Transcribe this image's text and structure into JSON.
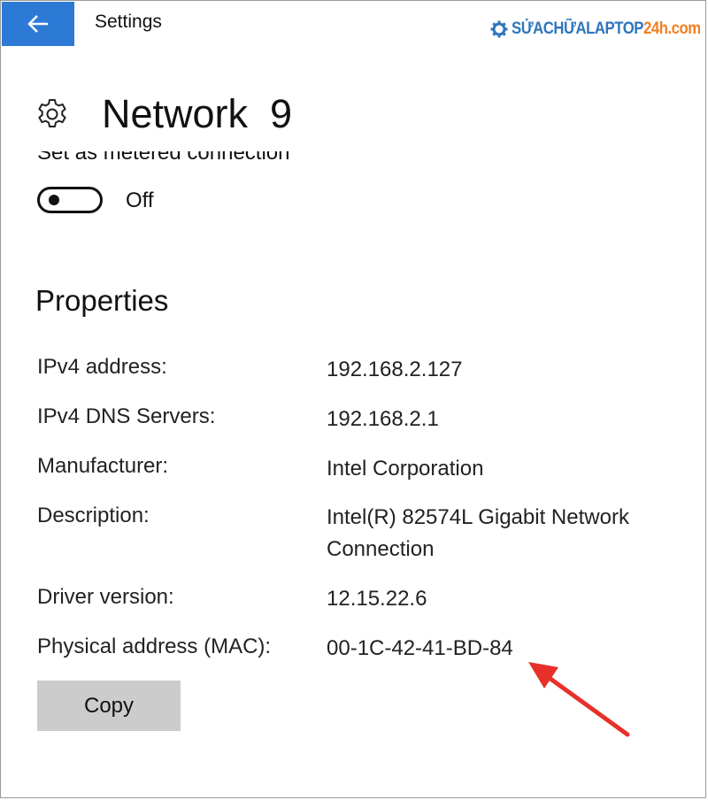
{
  "window": {
    "title": "Settings",
    "accent": "#2d7ad6"
  },
  "watermark": {
    "part_a": "SỬACHỮALAPTOP",
    "part_b": "24h.com",
    "icon": "gear-icon"
  },
  "page": {
    "icon": "gear-icon",
    "title": "Network  9"
  },
  "metered": {
    "label": "Set as metered connection",
    "state_label": "Off",
    "on": false
  },
  "properties": {
    "title": "Properties",
    "rows": [
      {
        "label": "IPv4 address:",
        "value": "192.168.2.127"
      },
      {
        "label": "IPv4 DNS Servers:",
        "value": "192.168.2.1"
      },
      {
        "label": "Manufacturer:",
        "value": "Intel Corporation"
      },
      {
        "label": "Description:",
        "value": "Intel(R) 82574L Gigabit Network",
        "value_line2": "Connection"
      },
      {
        "label": "Driver version:",
        "value": "12.15.22.6"
      },
      {
        "label": "Physical address (MAC):",
        "value": "00-1C-42-41-BD-84"
      }
    ],
    "copy_label": "Copy"
  },
  "annotation": {
    "arrow_color": "#e8302a"
  }
}
